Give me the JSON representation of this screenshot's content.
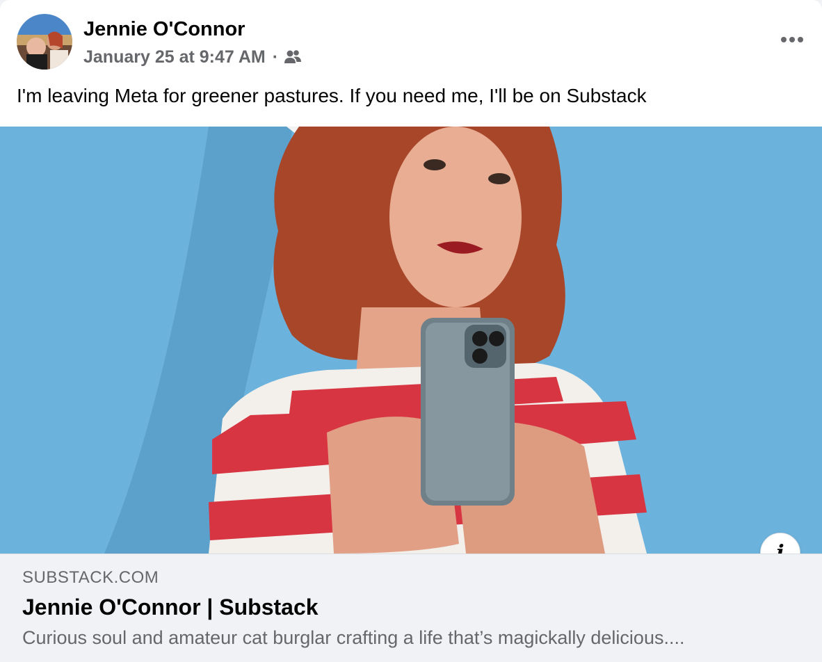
{
  "post": {
    "author_name": "Jennie O'Connor",
    "timestamp": "January 25 at 9:47 AM",
    "meta_separator": "·",
    "audience_icon": "friends-icon",
    "more_icon": "more-options-icon",
    "text": "I'm leaving Meta for greener pastures. If you need me, I'll be on Substack"
  },
  "link_preview": {
    "domain": "SUBSTACK.COM",
    "title": "Jennie O'Connor | Substack",
    "description": "Curious soul and amateur cat burglar crafting a life that’s magickally delicious....",
    "info_icon": "i"
  },
  "colors": {
    "image_background": "#6bb2dc",
    "secondary_text": "#65676b",
    "card_footer": "#f0f2f5"
  }
}
